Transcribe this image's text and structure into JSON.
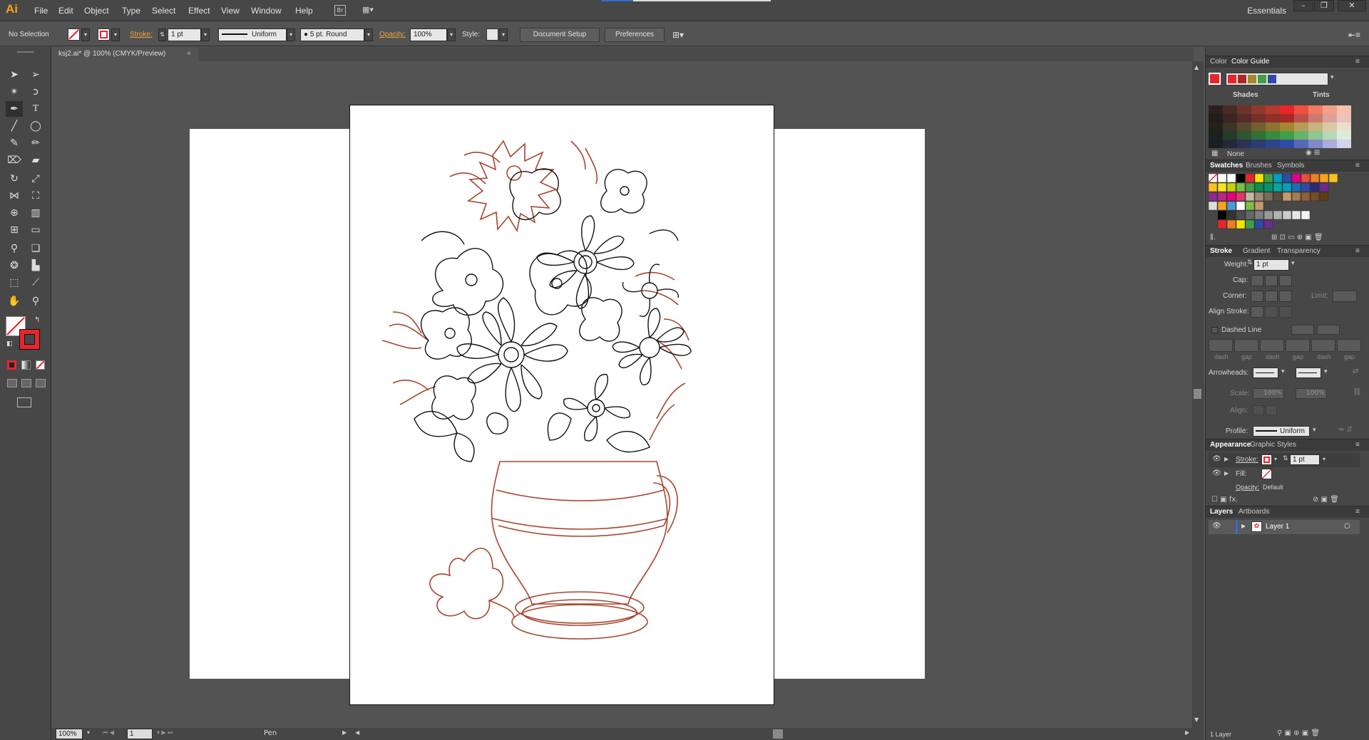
{
  "app": {
    "logo": "Ai",
    "workspace": "Essentials"
  },
  "menu": [
    "File",
    "Edit",
    "Object",
    "Type",
    "Select",
    "Effect",
    "View",
    "Window",
    "Help"
  ],
  "control": {
    "selection": "No Selection",
    "stroke_label": "Stroke:",
    "stroke_weight": "1 pt",
    "profile": "Uniform",
    "brush": "5 pt. Round",
    "opacity_label": "Opacity:",
    "opacity": "100%",
    "style_label": "Style:",
    "doc_setup": "Document Setup",
    "preferences": "Preferences"
  },
  "document": {
    "tab": "ksj2.ai* @ 100% (CMYK/Preview)"
  },
  "status": {
    "zoom": "100%",
    "artboard": "1",
    "tool": "Pen"
  },
  "colors": {
    "accent": "#e8252b",
    "stroke_art": "#a8442f"
  },
  "color_panel": {
    "tab1": "Color",
    "tab2": "Color Guide",
    "shades": "Shades",
    "tints": "Tints",
    "none": "None"
  },
  "swatch_panel": {
    "tab1": "Swatches",
    "tab2": "Brushes",
    "tab3": "Symbols"
  },
  "stroke_panel": {
    "tab1": "Stroke",
    "tab2": "Gradient",
    "tab3": "Transparency",
    "weight_label": "Weight:",
    "weight": "1 pt",
    "cap_label": "Cap:",
    "corner_label": "Corner:",
    "limit_label": "Limit:",
    "align_label": "Align Stroke:",
    "dashed": "Dashed Line",
    "dash_labels": [
      "dash",
      "gap",
      "dash",
      "gap",
      "dash",
      "gap"
    ],
    "arrowheads_label": "Arrowheads:",
    "scale_label": "Scale:",
    "scale1": "100%",
    "scale2": "100%",
    "align2_label": "Align:",
    "profile_label": "Profile:",
    "profile": "Uniform"
  },
  "appearance_panel": {
    "tab1": "Appearance",
    "tab2": "Graphic Styles",
    "stroke_label": "Stroke:",
    "stroke_weight": "1 pt",
    "fill_label": "Fill:",
    "opacity_label": "Opacity:",
    "opacity": "Default"
  },
  "layers_panel": {
    "tab1": "Layers",
    "tab2": "Artboards",
    "layer_name": "Layer 1",
    "footer": "1 Layer"
  }
}
